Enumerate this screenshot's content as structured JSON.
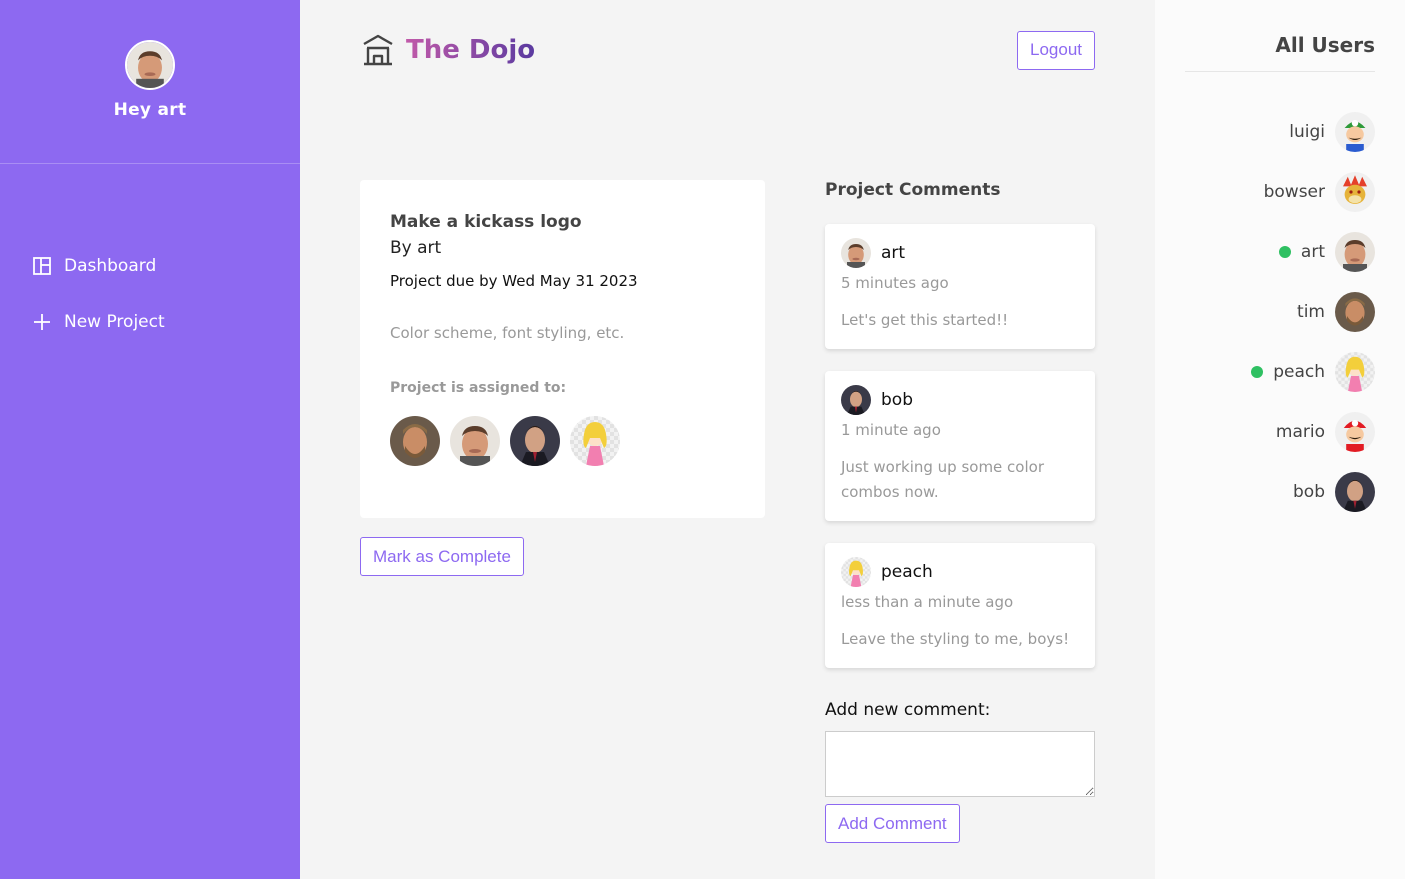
{
  "sidebar": {
    "greeting": "Hey art",
    "nav": [
      {
        "label": "Dashboard",
        "icon": "dashboard-icon"
      },
      {
        "label": "New Project",
        "icon": "plus-icon"
      }
    ]
  },
  "header": {
    "logo_text": "The Dojo",
    "logout_label": "Logout"
  },
  "project": {
    "title": "Make a kickass logo",
    "author": "By art",
    "due": "Project due by Wed May 31 2023",
    "details": "Color scheme, font styling, etc.",
    "assigned_label": "Project is assigned to:",
    "assigned": [
      "tim",
      "art",
      "bob",
      "peach"
    ],
    "complete_label": "Mark as Complete"
  },
  "comments": {
    "heading": "Project Comments",
    "items": [
      {
        "name": "art",
        "time": "5 minutes ago",
        "text": "Let's get this started!!"
      },
      {
        "name": "bob",
        "time": "1 minute ago",
        "text": "Just working up some color combos now."
      },
      {
        "name": "peach",
        "time": "less than a minute ago",
        "text": "Leave the styling to me, boys!"
      }
    ],
    "add_label": "Add new comment:",
    "add_button": "Add Comment"
  },
  "users": {
    "heading": "All Users",
    "list": [
      {
        "name": "luigi",
        "online": false
      },
      {
        "name": "bowser",
        "online": false
      },
      {
        "name": "art",
        "online": true
      },
      {
        "name": "tim",
        "online": false
      },
      {
        "name": "peach",
        "online": true
      },
      {
        "name": "mario",
        "online": false
      },
      {
        "name": "bob",
        "online": false
      }
    ]
  },
  "colors": {
    "accent": "#8d69f1",
    "online": "#2fc062"
  }
}
